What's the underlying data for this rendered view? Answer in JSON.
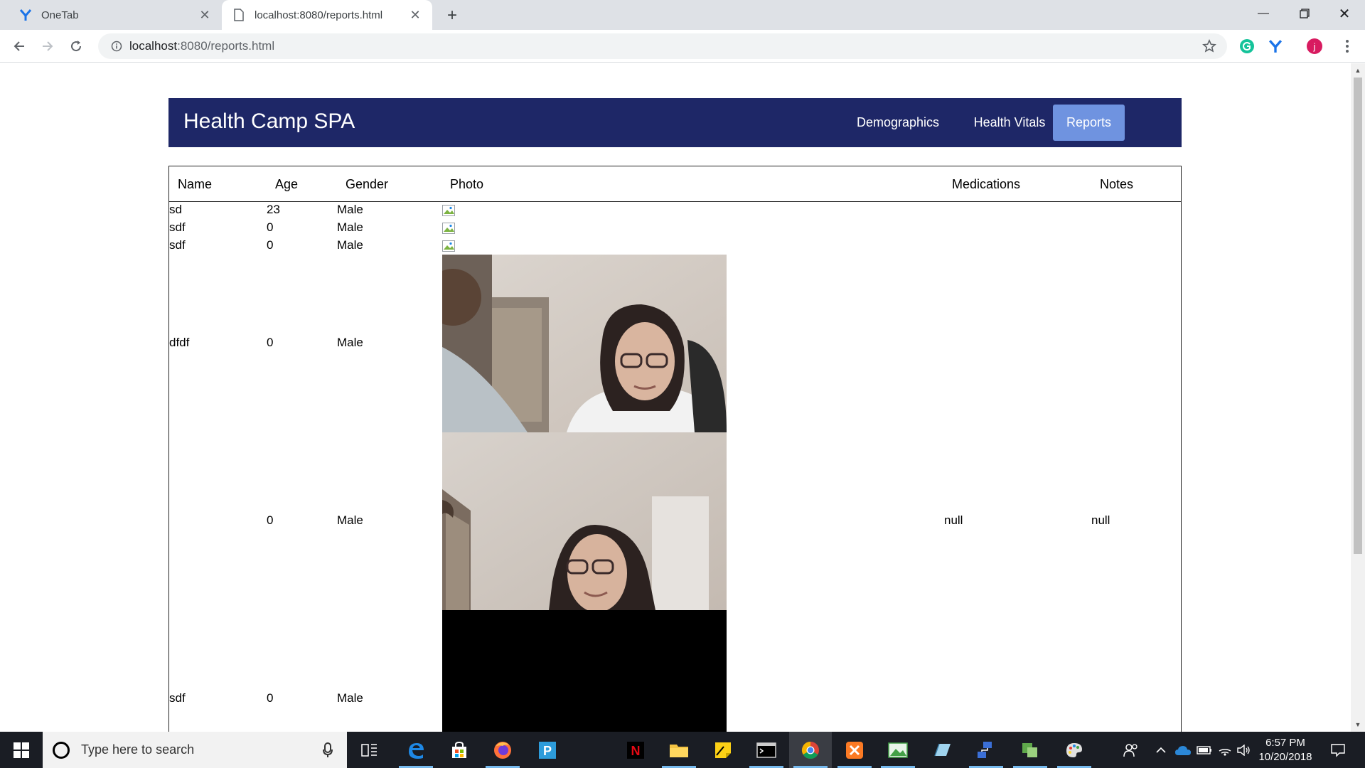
{
  "browser": {
    "tabs": [
      {
        "title": "OneTab"
      },
      {
        "title": "localhost:8080/reports.html"
      }
    ],
    "address": {
      "host": "localhost",
      "rest": ":8080/reports.html"
    }
  },
  "app": {
    "brand": "Health Camp SPA",
    "nav": [
      {
        "label": "Demographics"
      },
      {
        "label": "Health Vitals"
      },
      {
        "label": "Reports"
      }
    ],
    "active_nav": "Reports"
  },
  "table": {
    "headers": [
      "Name",
      "Age",
      "Gender",
      "Photo",
      "Medications",
      "Notes"
    ],
    "rows": [
      {
        "name": "sd",
        "age": "23",
        "gender": "Male",
        "medications": "",
        "notes": ""
      },
      {
        "name": "sdf",
        "age": "0",
        "gender": "Male",
        "medications": "",
        "notes": ""
      },
      {
        "name": "sdf",
        "age": "0",
        "gender": "Male",
        "medications": "",
        "notes": ""
      },
      {
        "name": "dfdf",
        "age": "0",
        "gender": "Male",
        "medications": "",
        "notes": ""
      },
      {
        "name": "",
        "age": "0",
        "gender": "Male",
        "medications": "null",
        "notes": "null"
      },
      {
        "name": "sdf",
        "age": "0",
        "gender": "Male",
        "medications": "",
        "notes": ""
      }
    ]
  },
  "taskbar": {
    "search_placeholder": "Type here to search",
    "time": "6:57 PM",
    "date": "10/20/2018"
  }
}
